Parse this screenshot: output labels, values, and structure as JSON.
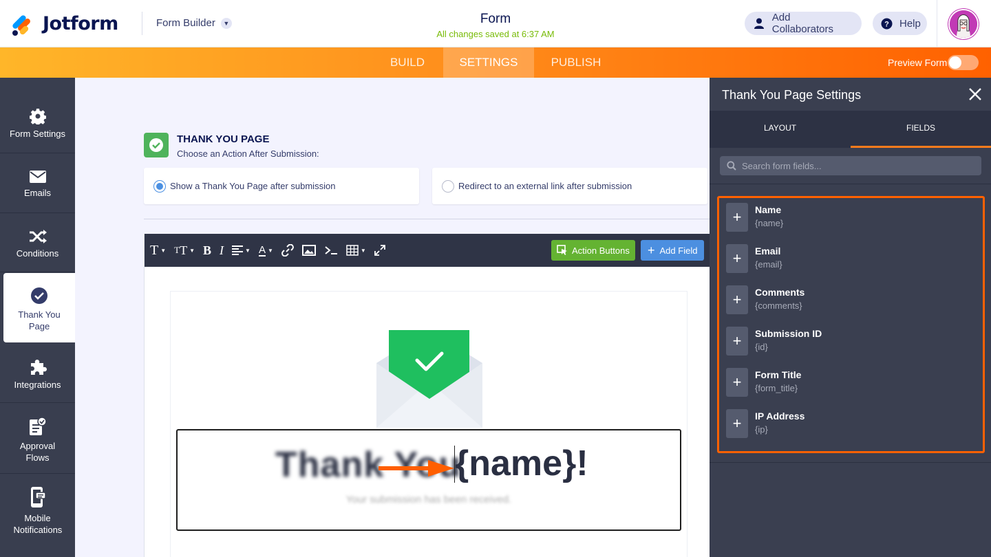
{
  "header": {
    "logo_text": "Jotform",
    "builder_label": "Form Builder",
    "form_title": "Form",
    "save_status": "All changes saved at 6:37 AM",
    "add_collaborators": "Add Collaborators",
    "help": "Help"
  },
  "nav": {
    "tabs": [
      "BUILD",
      "SETTINGS",
      "PUBLISH"
    ],
    "active_tab": "SETTINGS",
    "preview_label": "Preview Form",
    "preview_on": false
  },
  "sidebar": {
    "items": [
      {
        "label": "Form Settings",
        "icon": "gear-icon"
      },
      {
        "label": "Emails",
        "icon": "envelope-icon"
      },
      {
        "label": "Conditions",
        "icon": "shuffle-icon"
      },
      {
        "label": "Thank You Page",
        "icon": "check-circle-icon"
      },
      {
        "label": "Integrations",
        "icon": "puzzle-icon"
      },
      {
        "label": "Approval Flows",
        "icon": "approval-icon"
      },
      {
        "label": "Mobile Notifications",
        "icon": "mobile-icon"
      }
    ],
    "active": "Thank You Page"
  },
  "main": {
    "section_title": "THANK YOU PAGE",
    "section_subtitle": "Choose an Action After Submission:",
    "option_thankyou": "Show a Thank You Page after submission",
    "option_redirect": "Redirect to an external link after submission",
    "selected_option": "thankyou",
    "action_buttons": "Action Buttons",
    "add_field": "Add Field",
    "heading_text": "Thank You ",
    "heading_field": "{name}!",
    "subtext": "Your submission has been received."
  },
  "panel": {
    "title": "Thank You Page Settings",
    "tabs": [
      "LAYOUT",
      "FIELDS"
    ],
    "active_tab": "FIELDS",
    "search_placeholder": "Search form fields...",
    "fields": [
      {
        "name": "Name",
        "tag": "{name}"
      },
      {
        "name": "Email",
        "tag": "{email}"
      },
      {
        "name": "Comments",
        "tag": "{comments}"
      },
      {
        "name": "Submission ID",
        "tag": "{id}"
      },
      {
        "name": "Form Title",
        "tag": "{form_title}"
      },
      {
        "name": "IP Address",
        "tag": "{ip}"
      }
    ]
  },
  "colors": {
    "brand_orange": "#ff6100",
    "brand_navy": "#0a1551",
    "success_green": "#64b332",
    "action_blue": "#4c8fe0"
  }
}
